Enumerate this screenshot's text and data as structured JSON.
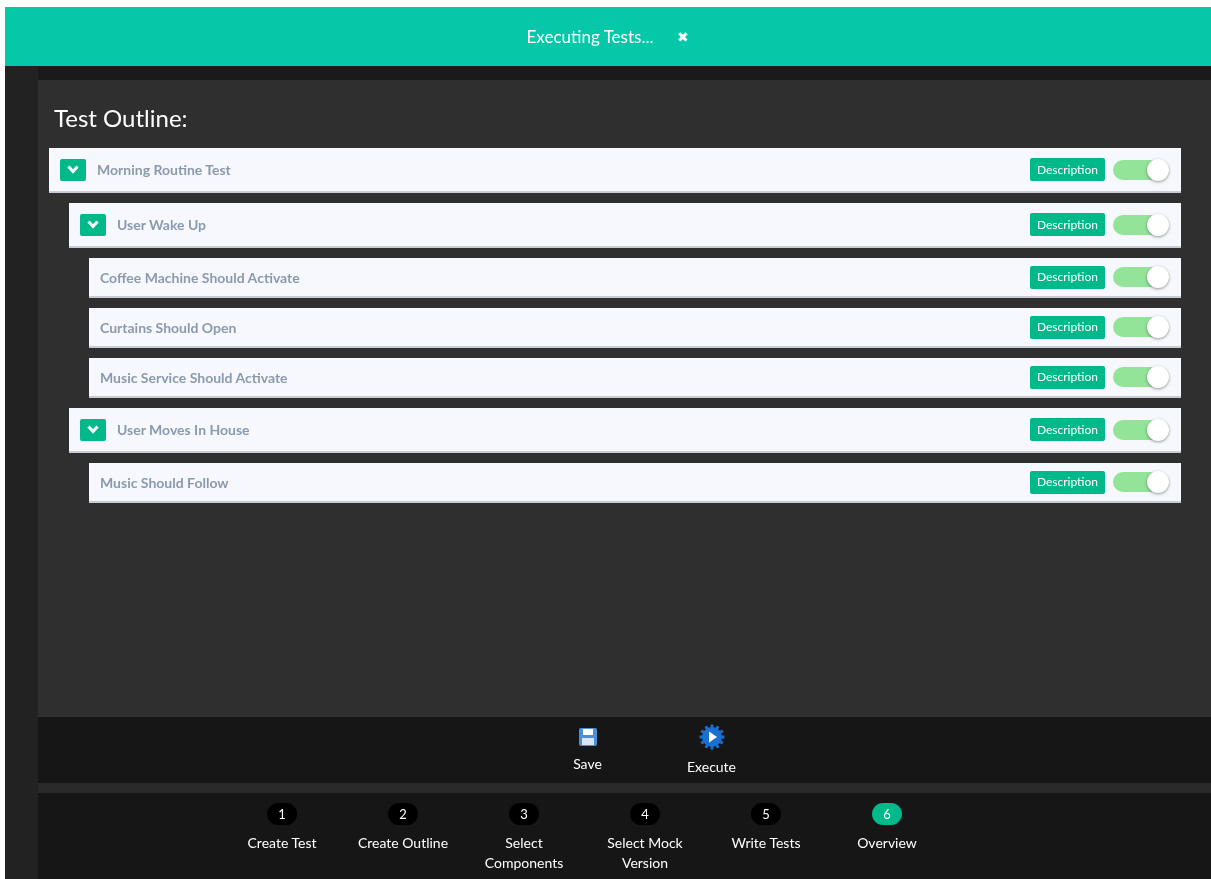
{
  "banner": {
    "title": "Executing Tests...",
    "close": "✖"
  },
  "outline": {
    "title": "Test Outline:",
    "items": [
      {
        "label": "Morning Routine Test",
        "expanded": true,
        "description": "Description",
        "on": true,
        "children": [
          {
            "label": "User Wake Up",
            "expanded": true,
            "description": "Description",
            "on": true,
            "children": [
              {
                "label": "Coffee Machine Should Activate",
                "description": "Description",
                "on": true
              },
              {
                "label": "Curtains Should Open",
                "description": "Description",
                "on": true
              },
              {
                "label": "Music Service Should Activate",
                "description": "Description",
                "on": true
              }
            ]
          },
          {
            "label": "User Moves In House",
            "expanded": true,
            "description": "Description",
            "on": true,
            "children": [
              {
                "label": "Music Should Follow",
                "description": "Description",
                "on": true
              }
            ]
          }
        ]
      }
    ]
  },
  "toolbar": [
    {
      "kind": "save",
      "label": "Save"
    },
    {
      "kind": "execute",
      "label": "Execute"
    }
  ],
  "steps": [
    {
      "number": "1",
      "label": "Create Test",
      "selected": false
    },
    {
      "number": "2",
      "label": "Create Outline",
      "selected": false
    },
    {
      "number": "3",
      "label": "Select Components",
      "selected": false
    },
    {
      "number": "4",
      "label": "Select Mock Version",
      "selected": false
    },
    {
      "number": "5",
      "label": "Write Tests",
      "selected": false
    },
    {
      "number": "6",
      "label": "Overview",
      "selected": true
    }
  ]
}
